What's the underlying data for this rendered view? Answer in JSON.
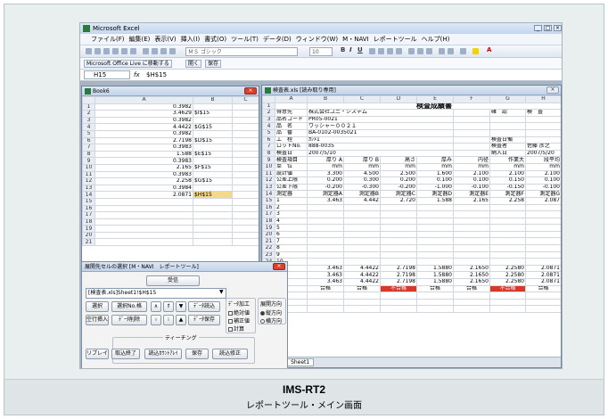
{
  "excel": {
    "title": "Microsoft Excel",
    "menu": [
      "ファイル(F)",
      "編集(E)",
      "表示(V)",
      "挿入(I)",
      "書式(O)",
      "ツール(T)",
      "データ(D)",
      "ウィンドウ(W)",
      "M・NAVI",
      "レポートツール",
      "ヘルプ(H)"
    ],
    "font_name": "ＭＳ ゴシック",
    "font_size": "10",
    "live_label": "Microsoft Office Live に移動する",
    "live_open": "開く",
    "live_save": "保存",
    "name_box": "H15",
    "formula": "$H$15"
  },
  "book6": {
    "title": "Book6",
    "columns": [
      "A",
      "B",
      "C"
    ],
    "rows": [
      {
        "n": "1",
        "a": "0.3982",
        "b": ""
      },
      {
        "n": "2",
        "a": "3.4629",
        "b": "$I$15"
      },
      {
        "n": "3",
        "a": "0.3982",
        "b": ""
      },
      {
        "n": "4",
        "a": "4.4422",
        "b": "$G$15"
      },
      {
        "n": "5",
        "a": "0.3982",
        "b": ""
      },
      {
        "n": "6",
        "a": "2.7198",
        "b": "$D$15"
      },
      {
        "n": "7",
        "a": "0.3983",
        "b": ""
      },
      {
        "n": "8",
        "a": "1.588",
        "b": "$E$15"
      },
      {
        "n": "9",
        "a": "0.3983",
        "b": ""
      },
      {
        "n": "10",
        "a": "2.165",
        "b": "$F$15"
      },
      {
        "n": "11",
        "a": "0.3983",
        "b": ""
      },
      {
        "n": "12",
        "a": "2.258",
        "b": "$G$15"
      },
      {
        "n": "13",
        "a": "0.3984",
        "b": ""
      },
      {
        "n": "14",
        "a": "2.0871",
        "b": "$H$15"
      },
      {
        "n": "15",
        "a": "",
        "b": ""
      },
      {
        "n": "16",
        "a": "",
        "b": ""
      },
      {
        "n": "17",
        "a": "",
        "b": ""
      },
      {
        "n": "18",
        "a": "",
        "b": ""
      },
      {
        "n": "19",
        "a": "",
        "b": ""
      },
      {
        "n": "20",
        "a": "",
        "b": ""
      },
      {
        "n": "21",
        "a": "",
        "b": ""
      }
    ]
  },
  "report": {
    "title": "検査表.xls [読み取り専用]",
    "columns": [
      "A",
      "B",
      "C",
      "D",
      "E",
      "F",
      "G",
      "H"
    ],
    "sheet_title": "検査成績書",
    "header_rows": [
      {
        "n": "2",
        "label": "得意先",
        "value": "株式会社ユニ・システム",
        "g": "確　認",
        "h": "検　査"
      },
      {
        "n": "3",
        "label": "品名コード",
        "value": "PR05-0021",
        "g": "",
        "h": ""
      },
      {
        "n": "4",
        "label": "品　名",
        "value": "ワッシャー００２１",
        "g": "",
        "h": ""
      },
      {
        "n": "5",
        "label": "品　番",
        "value": "BA-0102-0035021",
        "g": "",
        "h": ""
      },
      {
        "n": "6",
        "label": "工　程",
        "value": "ｶｼﾒ1",
        "g": "検査日備",
        "h": ""
      },
      {
        "n": "7",
        "label": "ロットNo.",
        "value": "888-0035",
        "g": "検査者",
        "h": "佐藤 彦之"
      },
      {
        "n": "8",
        "label": "検査日",
        "value": "2007/5/10",
        "g": "納入日",
        "h": "2007/5/20"
      }
    ],
    "items_row": [
      "検査項目",
      "厚り A",
      "厚り B",
      "高さ",
      "厚み",
      "内径",
      "作業大",
      "段平均"
    ],
    "unit_row": [
      "単　位",
      "mm",
      "mm",
      "mm",
      "mm",
      "mm",
      "mm",
      "mm"
    ],
    "spec_rows": [
      {
        "n": "11",
        "label": "設計値",
        "vals": [
          "3.300",
          "4.500",
          "2.500",
          "1.600",
          "2.100",
          "2.100",
          "2.100"
        ]
      },
      {
        "n": "12",
        "label": "公差上限",
        "vals": [
          "0.200",
          "0.300",
          "0.200",
          "0.100",
          "0.100",
          "0.150",
          "0.100"
        ]
      },
      {
        "n": "13",
        "label": "公差下限",
        "vals": [
          "-0.200",
          "-0.300",
          "-0.200",
          "-1.000",
          "-0.100",
          "-0.150",
          "-0.100"
        ]
      }
    ],
    "method_row": [
      "測定器",
      "測定器A",
      "測定器B",
      "測定器C",
      "測定器D",
      "測定器E",
      "測定器F",
      "測定器G"
    ],
    "data_rows": [
      {
        "n": "15",
        "label": "1",
        "vals": [
          "3.463",
          "4.442",
          "2.720",
          "1.588",
          "2.165",
          "2.258",
          "2.087"
        ]
      },
      {
        "n": "16",
        "label": "2",
        "vals": [
          "",
          "",
          "",
          "",
          "",
          "",
          ""
        ]
      },
      {
        "n": "17",
        "label": "3",
        "vals": [
          "",
          "",
          "",
          "",
          "",
          "",
          ""
        ]
      },
      {
        "n": "18",
        "label": "4",
        "vals": [
          "",
          "",
          "",
          "",
          "",
          "",
          ""
        ]
      },
      {
        "n": "19",
        "label": "5",
        "vals": [
          "",
          "",
          "",
          "",
          "",
          "",
          ""
        ]
      },
      {
        "n": "20",
        "label": "6",
        "vals": [
          "",
          "",
          "",
          "",
          "",
          "",
          ""
        ]
      },
      {
        "n": "21",
        "label": "7",
        "vals": [
          "",
          "",
          "",
          "",
          "",
          "",
          ""
        ]
      },
      {
        "n": "22",
        "label": "8",
        "vals": [
          "",
          "",
          "",
          "",
          "",
          "",
          ""
        ]
      },
      {
        "n": "23",
        "label": "9",
        "vals": [
          "",
          "",
          "",
          "",
          "",
          "",
          ""
        ]
      },
      {
        "n": "24",
        "label": "10",
        "vals": [
          "",
          "",
          "",
          "",
          "",
          "",
          ""
        ]
      }
    ],
    "stat_rows": [
      {
        "n": "25",
        "label": "大",
        "vals": [
          "3.463",
          "4.4422",
          "2.7198",
          "1.5880",
          "2.1650",
          "2.2580",
          "2.0871"
        ]
      },
      {
        "n": "26",
        "label": "小",
        "vals": [
          "3.463",
          "4.4422",
          "2.7198",
          "1.5880",
          "2.1650",
          "2.2580",
          "2.0871"
        ]
      },
      {
        "n": "27",
        "label": "均",
        "vals": [
          "3.463",
          "4.4422",
          "2.7198",
          "1.5880",
          "2.1650",
          "2.2580",
          "2.0871"
        ]
      }
    ],
    "judge_row": {
      "n": "28",
      "label": "判定",
      "vals": [
        "合格",
        "合格",
        "不合格",
        "合格",
        "合格",
        "不合格",
        "合格"
      ]
    },
    "extra_rows": [
      {
        "n": "29",
        "label": "Cp"
      },
      {
        "n": "30",
        "label": "Cpk"
      },
      {
        "n": "31",
        "label": "考"
      }
    ],
    "sheet_tab": "Sheet1"
  },
  "dialog": {
    "title": "展開先セルの選択 [M・NAVI　レポートツール]",
    "receive_label": "受信",
    "path_value": "[検査表.xls]Sheet1!$H$15",
    "buttons": {
      "select": "選択",
      "select_no": "選択No.格",
      "data_read": "ﾃﾞｰﾀ読込",
      "empty_insert": "空行挿入",
      "data_delete": "ﾃﾞｰﾀ削除",
      "data_save": "ﾃﾞｰﾀ保存",
      "replay": "リプレイ",
      "close": "取込終了",
      "read_array": "読込ｶｳﾝﾄｱﾚｲ",
      "save": "保存",
      "read_fix": "読込修正"
    },
    "data_process_label": "ﾃﾞｰﾀ加工",
    "checks": [
      "絶対値",
      "補正値",
      "計算"
    ],
    "direction_label": "展開方向",
    "directions": [
      "縦方向",
      "横方向"
    ],
    "teaching_label": "ティーチング"
  },
  "caption": {
    "title": "IMS-RT2",
    "subtitle": "レポートツール・メイン画面"
  }
}
